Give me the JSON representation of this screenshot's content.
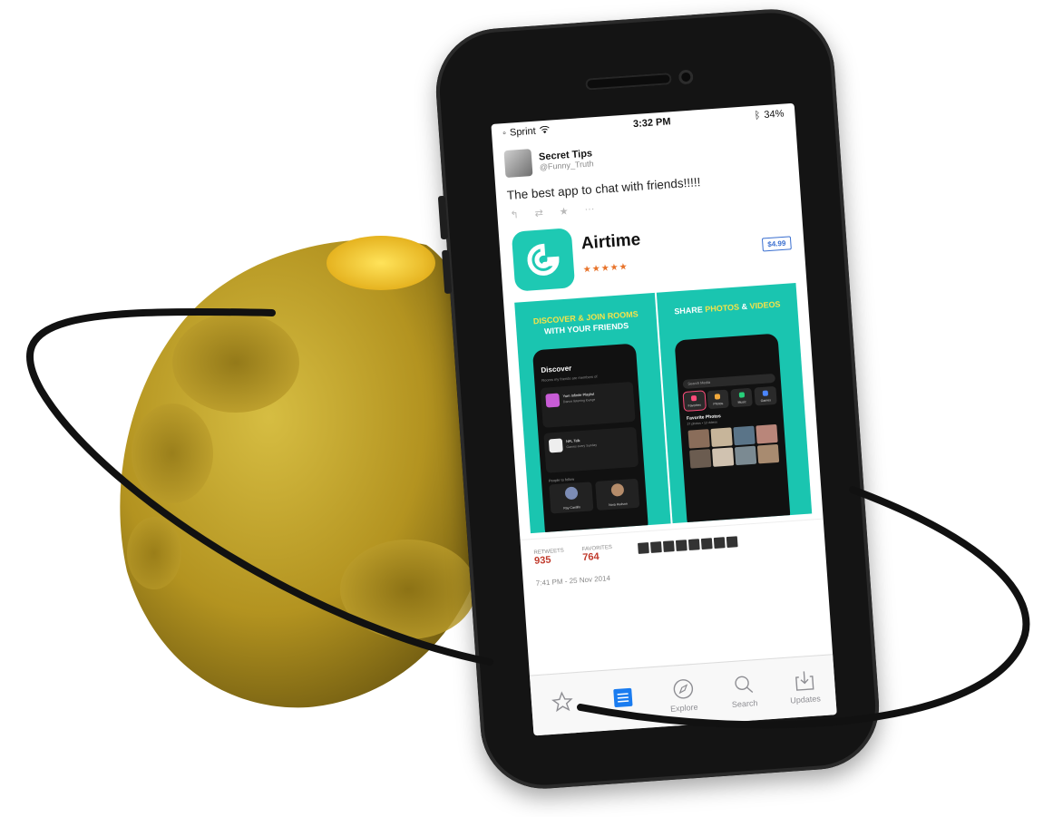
{
  "status_bar": {
    "carrier": "Sprint",
    "time": "3:32 PM",
    "battery": "34%"
  },
  "tweet": {
    "author_name": "Secret Tips",
    "author_handle": "@Funny_Truth",
    "text": "The best app to chat with friends!!!!!",
    "retweets_label": "RETWEETS",
    "retweets_count": "935",
    "favorites_label": "FAVORITES",
    "favorites_count": "764",
    "timestamp": "7:41 PM - 25 Nov 2014"
  },
  "app": {
    "name": "Airtime",
    "price": "$4.99",
    "stars": "★★★★★",
    "accent": "#1ec9b3",
    "screenshots": [
      {
        "title_line1": "Discover & Join Rooms",
        "title_line2": "With Your Friends",
        "screen_title": "Discover",
        "screen_subtitle": "Rooms my friends are members of",
        "card1_title": "Yum Infinite Playlist",
        "card1_sub": "Dance listening lounge",
        "card2_title": "NFL Talk",
        "card2_sub": "Games every Sunday",
        "people_label": "People to follow",
        "person1": "Ray Castillo",
        "person2": "Nora Hudson"
      },
      {
        "title_plain": "Share ",
        "title_highlight1": "Photos",
        "title_mid": " & ",
        "title_highlight2": "Videos",
        "search_placeholder": "Search Media",
        "categories": [
          "Favorites",
          "Photos",
          "Music",
          "Games"
        ],
        "favorites_title": "Favorite Photos",
        "favorites_sub": "27 photos • 13 videos"
      }
    ]
  },
  "tab_bar": {
    "items": [
      {
        "label": "",
        "icon": "star-icon"
      },
      {
        "label": "",
        "icon": "list-icon"
      },
      {
        "label": "Explore",
        "icon": "compass-icon"
      },
      {
        "label": "Search",
        "icon": "search-icon"
      },
      {
        "label": "Updates",
        "icon": "download-icon"
      }
    ]
  },
  "colors": {
    "planet": "#c9a92a",
    "ring": "#111111",
    "phone_body": "#141414"
  }
}
